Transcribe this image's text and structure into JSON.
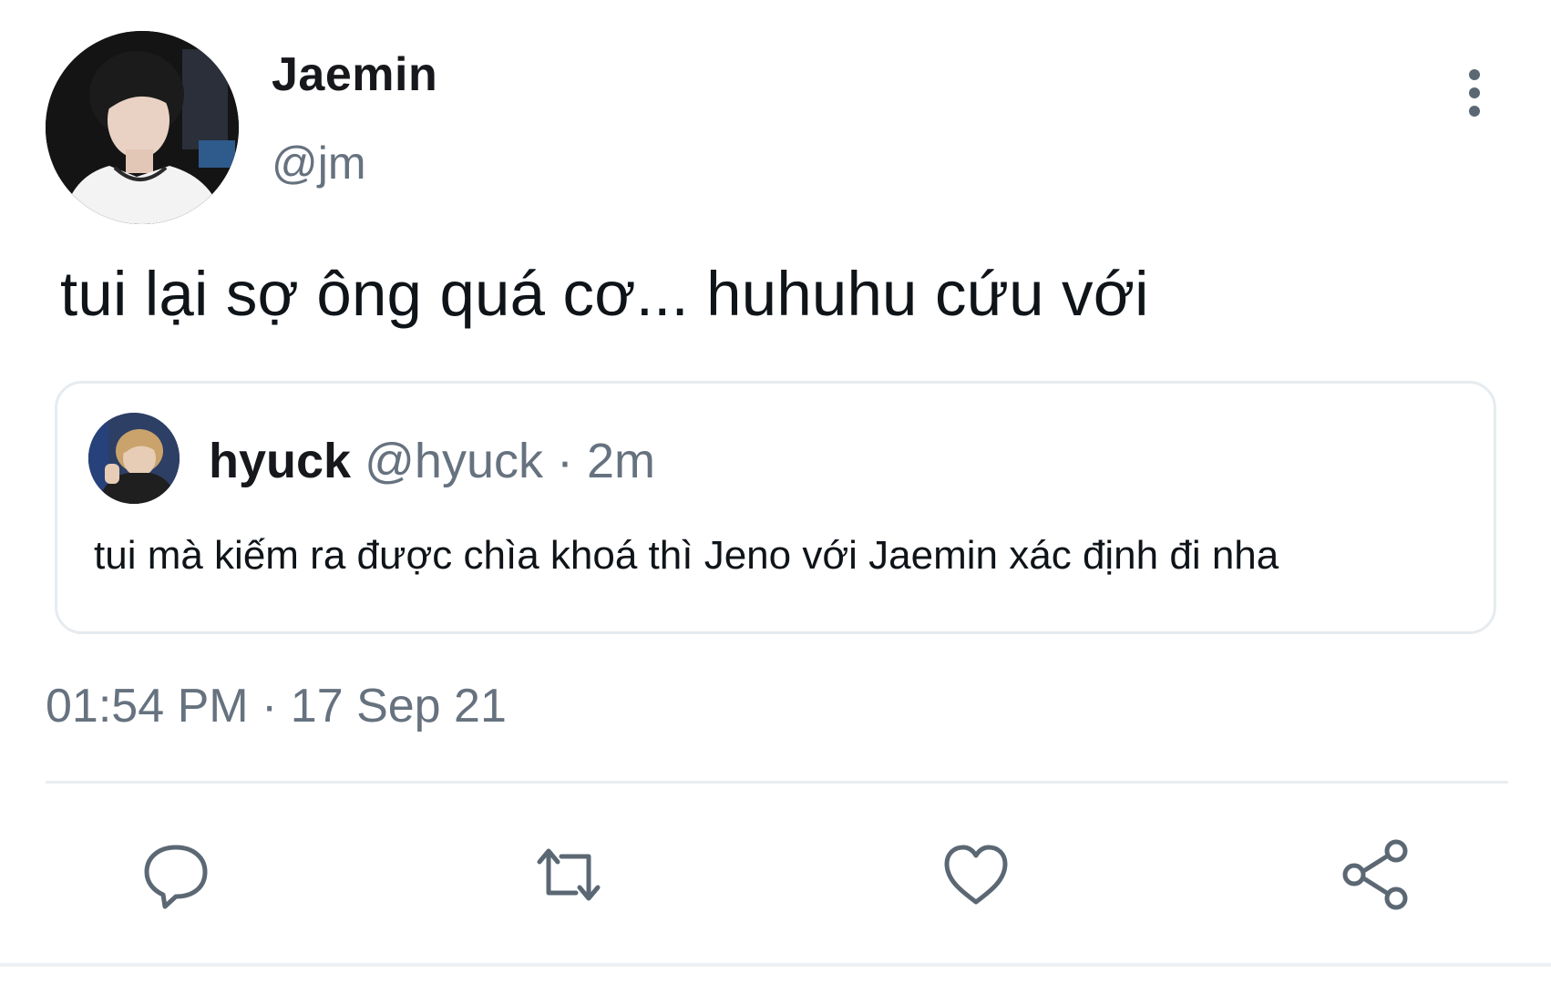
{
  "tweet": {
    "author": {
      "display_name": "Jaemin",
      "handle": "@jm"
    },
    "text": "tui lại sợ ông quá cơ... huhuhu cứu với",
    "timestamp": "01:54 PM · 17 Sep 21",
    "more_icon": "more-vertical-icon"
  },
  "quoted_tweet": {
    "author": {
      "display_name": "hyuck",
      "handle": "@hyuck"
    },
    "meta_separator": " · ",
    "time_ago": "2m",
    "text": "tui mà kiếm ra được chìa khoá thì Jeno với Jaemin xác định đi nha"
  },
  "actions": [
    {
      "name": "reply",
      "icon": "speech-bubble-icon"
    },
    {
      "name": "retweet",
      "icon": "retweet-arrows-icon"
    },
    {
      "name": "like",
      "icon": "heart-icon"
    },
    {
      "name": "share",
      "icon": "share-nodes-icon"
    }
  ],
  "colors": {
    "text_primary": "#0f1419",
    "text_secondary": "#66727f",
    "border": "#e6ebef",
    "icon": "#5b6874"
  }
}
